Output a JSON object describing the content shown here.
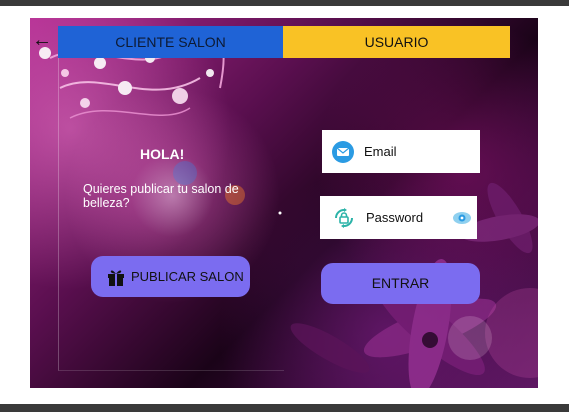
{
  "tabs": {
    "cliente": "CLIENTE SALON",
    "usuario": "USUARIO"
  },
  "left": {
    "greeting": "HOLA!",
    "question": "Quieres publicar tu salon de belleza?",
    "publish_button": "PUBLICAR SALON"
  },
  "login": {
    "email_label": "Email",
    "password_label": "Password",
    "enter_button": "ENTRAR"
  },
  "colors": {
    "tab_cliente": "#1f63d6",
    "tab_usuario": "#f9c225",
    "button": "#7b6cf0",
    "icon_blue": "#2b9be3"
  },
  "icons": {
    "back": "arrow-left-icon",
    "email": "email-icon",
    "password": "lock-icon",
    "visibility": "eye-icon",
    "publish": "gift-icon"
  }
}
